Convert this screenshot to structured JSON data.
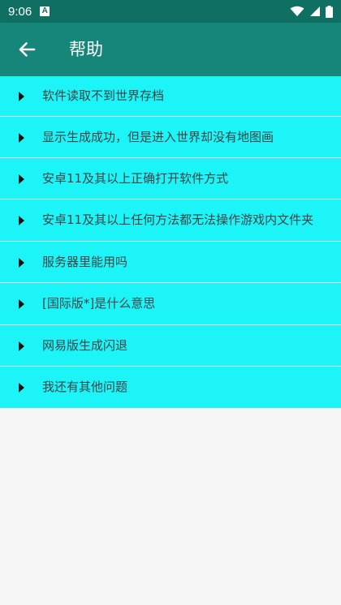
{
  "status_bar": {
    "time": "9:06",
    "notification_glyph": "A",
    "icons": [
      "wifi-icon",
      "cell-signal-icon",
      "battery-icon"
    ]
  },
  "app_bar": {
    "title": "帮助",
    "back_icon": "arrow-back-icon"
  },
  "help_items": [
    {
      "label": "软件读取不到世界存档"
    },
    {
      "label": "显示生成成功，但是进入世界却没有地图画"
    },
    {
      "label": "安卓11及其以上正确打开软件方式"
    },
    {
      "label": "安卓11及其以上任何方法都无法操作游戏内文件夹"
    },
    {
      "label": "服务器里能用吗"
    },
    {
      "label": "[国际版*]是什么意思"
    },
    {
      "label": "网易版生成闪退"
    },
    {
      "label": "我还有其他问题"
    }
  ],
  "colors": {
    "status_bar": "#0f6f63",
    "app_bar": "#16867a",
    "list_item_bg": "#1df4f7",
    "page_bg": "#f6f6f6"
  }
}
